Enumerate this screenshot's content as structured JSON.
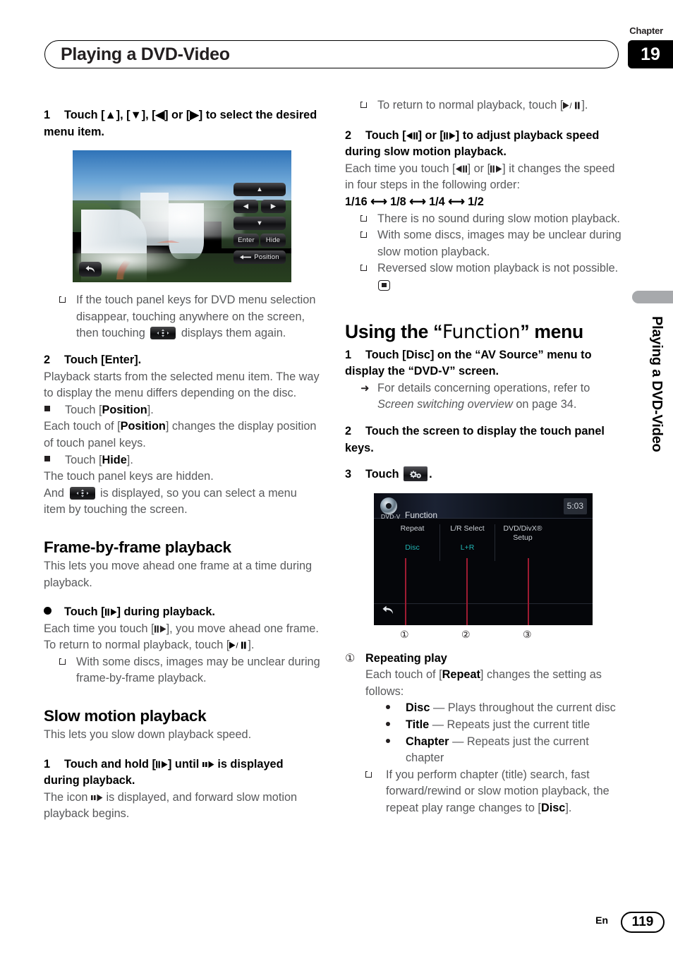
{
  "header": {
    "chapter_label": "Chapter",
    "chapter_number": "19",
    "title": "Playing a DVD-Video"
  },
  "side_tab_text": "Playing a DVD-Video",
  "footer": {
    "lang": "En",
    "page": "119"
  },
  "left_column": {
    "step1": {
      "num": "1",
      "text": "Touch [▲], [▼], [◀] or [▶] to select the desired menu item."
    },
    "dvd_menu_figure": {
      "buttons": {
        "up": "▲",
        "left": "◀",
        "right": "▶",
        "down": "▼",
        "enter": "Enter",
        "hide": "Hide",
        "position": "Position",
        "back": "↶"
      }
    },
    "note1": "If the touch panel keys for DVD menu selection disappear, touching anywhere on the screen, then touching",
    "note1_tail": "displays them again.",
    "step2": {
      "num": "2",
      "text": "Touch [Enter]."
    },
    "step2_body": "Playback starts from the selected menu item. The way to display the menu differs depending on the disc.",
    "sq1_label": "Touch [",
    "sq1_bold": "Position",
    "sq1_tail": "].",
    "sq1_body_a": "Each touch of [",
    "sq1_body_b": "Position",
    "sq1_body_c": "] changes the display position of touch panel keys.",
    "sq2_label": "Touch [",
    "sq2_bold": "Hide",
    "sq2_tail": "].",
    "sq2_body": "The touch panel keys are hidden.",
    "sq2_body2_a": "And",
    "sq2_body2_b": "is displayed, so you can select a menu item by touching the screen.",
    "heading_frame": "Frame-by-frame playback",
    "frame_intro": "This lets you move ahead one frame at a time during playback.",
    "frame_bullet_a": "Touch [",
    "frame_bullet_b": "] during playback.",
    "frame_body_a": "Each time you touch [",
    "frame_body_b": "], you move ahead one frame.",
    "frame_body2_a": "To return to normal playback, touch [",
    "frame_body2_b": "].",
    "frame_note": "With some discs, images may be unclear during frame-by-frame playback.",
    "heading_slow": "Slow motion playback",
    "slow_intro": "This lets you slow down playback speed.",
    "slow_step_num": "1",
    "slow_step_a": "Touch and hold [",
    "slow_step_b": "] until",
    "slow_step_c": "is displayed during playback.",
    "slow_body_a": "The icon",
    "slow_body_b": "is displayed, and forward slow motion playback begins."
  },
  "right_column": {
    "note_return_a": "To return to normal playback, touch [",
    "note_return_b": "].",
    "step2": {
      "num": "2",
      "a": "Touch [",
      "b": "] or [",
      "c": "] to adjust playback speed during slow motion playback."
    },
    "step2_body_a": "Each time you touch [",
    "step2_body_b": "] or [",
    "step2_body_c": "] it changes the speed in four steps in the following order:",
    "speed_sequence": "1/16 ⟷ 1/8 ⟷ 1/4 ⟷ 1/2",
    "notes": [
      "There is no sound during slow motion playback.",
      "With some discs, images may be unclear during slow motion playback.",
      "Reversed slow motion playback is not possible."
    ],
    "heading_function_a": "Using the “",
    "heading_function_b": "Function",
    "heading_function_c": "” menu",
    "fn_step1_num": "1",
    "fn_step1": "Touch [Disc] on the “AV Source” menu to display the “DVD-V” screen.",
    "fn_ref_a": "For details concerning operations, refer to ",
    "fn_ref_italic": "Screen switching overview",
    "fn_ref_b": " on page 34.",
    "fn_step2_num": "2",
    "fn_step2": "Touch the screen to display the touch panel keys.",
    "fn_step3_num": "3",
    "fn_step3_a": "Touch",
    "fn_step3_b": ".",
    "function_figure": {
      "source_label": "DVD-V",
      "screen_title": "Function",
      "clock": "5:03",
      "cells": [
        {
          "title": "Repeat",
          "value": "Disc"
        },
        {
          "title": "L/R Select",
          "value": "L+R"
        },
        {
          "title": "DVD/DivX® Setup",
          "value": ""
        }
      ],
      "callout_numbers": [
        "①",
        "②",
        "③"
      ]
    },
    "item1_marker": "①",
    "item1_title": "Repeating play",
    "item1_body_a": "Each touch of [",
    "item1_body_b": "Repeat",
    "item1_body_c": "] changes the setting as follows:",
    "repeat_options": [
      {
        "name": "Disc",
        "desc": "— Plays throughout the current disc"
      },
      {
        "name": "Title",
        "desc": "— Repeats just the current title"
      },
      {
        "name": "Chapter",
        "desc": "— Repeats just the current chapter"
      }
    ],
    "item1_note_a": "If you perform chapter (title) search, fast forward/rewind or slow motion playback, the repeat play range changes to [",
    "item1_note_b": "Disc",
    "item1_note_c": "]."
  }
}
